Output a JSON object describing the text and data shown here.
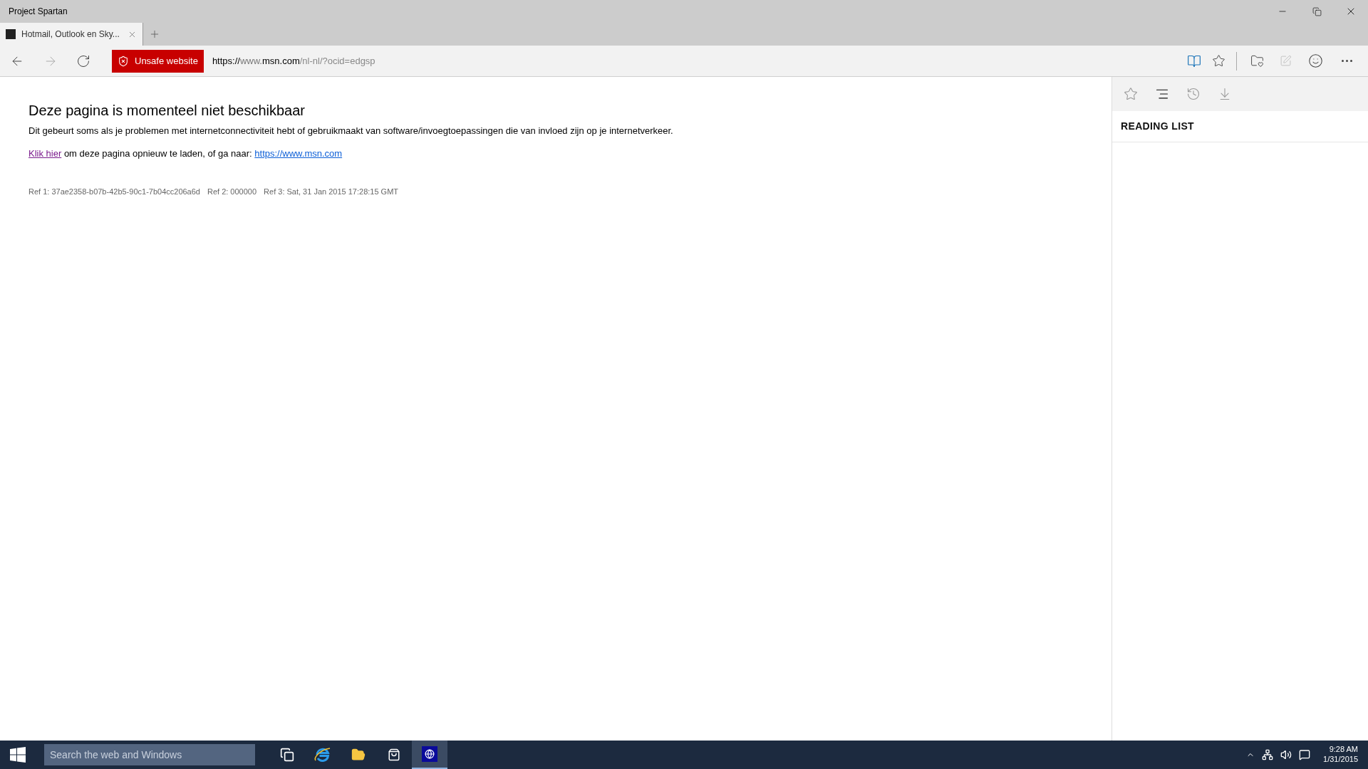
{
  "window": {
    "title": "Project Spartan"
  },
  "tabs": [
    {
      "label": "Hotmail, Outlook en Sky...",
      "selected": true
    }
  ],
  "address_bar": {
    "security_badge": "Unsafe website",
    "url_host_prefix": "https://",
    "url_host_dim": "www.",
    "url_host": "msn.com",
    "url_path": "/nl-nl/?ocid=edgsp"
  },
  "page": {
    "heading": "Deze pagina is momenteel niet beschikbaar",
    "message": "Dit gebeurt soms als je problemen met internetconnectiviteit hebt of gebruikmaakt van software/invoegtoepassingen die van invloed zijn op je internetverkeer.",
    "reload_link": "Klik hier",
    "reload_text": "om deze pagina opnieuw te laden, of ga naar:",
    "home_link": "https://www.msn.com",
    "refs": [
      "Ref 1: 37ae2358-b07b-42b5-90c1-7b04cc206a6d",
      "Ref 2: 000000",
      "Ref 3: Sat, 31 Jan 2015 17:28:15 GMT"
    ]
  },
  "hub": {
    "tabs": [
      {
        "kind": "favorites",
        "selected": false
      },
      {
        "kind": "reading-list",
        "selected": true
      },
      {
        "kind": "history",
        "selected": false
      },
      {
        "kind": "downloads",
        "selected": false
      }
    ],
    "title": "READING LIST"
  },
  "taskbar": {
    "search_placeholder": "Search the web and Windows",
    "time": "9:28 AM",
    "date": "1/31/2015"
  }
}
